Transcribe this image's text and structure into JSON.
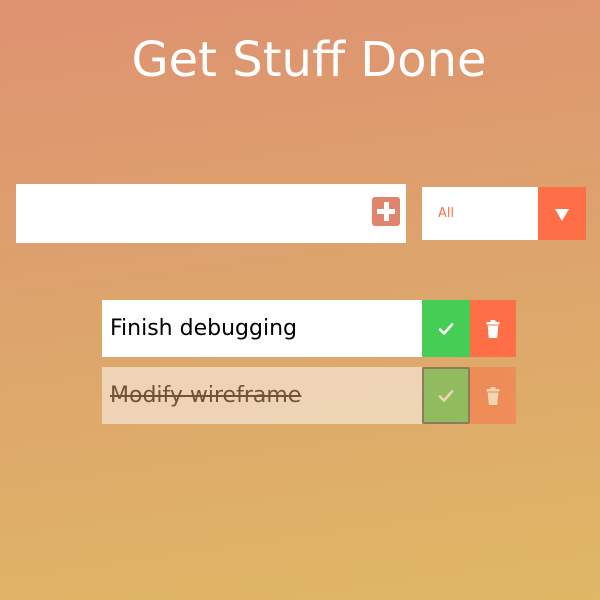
{
  "header": {
    "title": "Get Stuff Done"
  },
  "input": {
    "value": "",
    "placeholder": "",
    "add_icon": "plus-icon"
  },
  "filter": {
    "selected": "All",
    "arrow_icon": "caret-down-icon"
  },
  "todos": [
    {
      "text": "Finish debugging",
      "completed": false,
      "check_icon": "check-icon",
      "trash_icon": "trash-icon"
    },
    {
      "text": "Modify wireframe",
      "completed": true,
      "check_icon": "check-icon",
      "trash_icon": "trash-icon"
    }
  ],
  "colors": {
    "background_top": "#de9271",
    "background_bottom": "#dfb765",
    "accent": "#ff6f47",
    "add_button": "#e0836f",
    "complete": "#46cd55"
  }
}
